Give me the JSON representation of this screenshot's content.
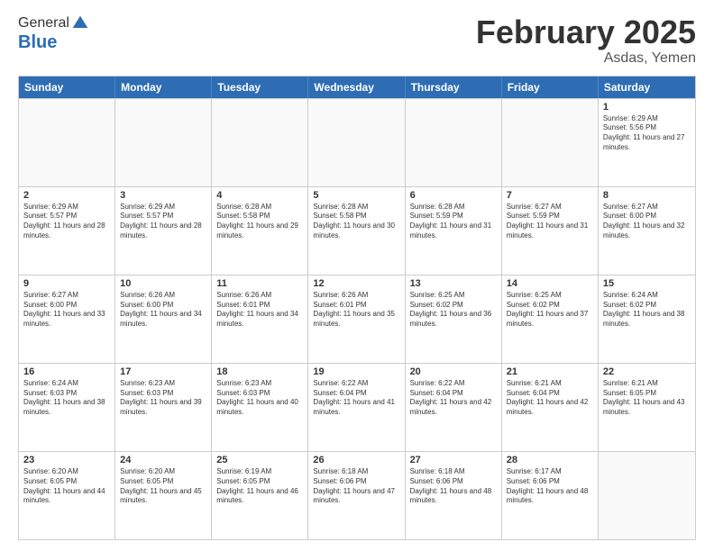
{
  "logo": {
    "general": "General",
    "blue": "Blue"
  },
  "title": "February 2025",
  "subtitle": "Asdas, Yemen",
  "headers": [
    "Sunday",
    "Monday",
    "Tuesday",
    "Wednesday",
    "Thursday",
    "Friday",
    "Saturday"
  ],
  "rows": [
    [
      {
        "day": "",
        "text": ""
      },
      {
        "day": "",
        "text": ""
      },
      {
        "day": "",
        "text": ""
      },
      {
        "day": "",
        "text": ""
      },
      {
        "day": "",
        "text": ""
      },
      {
        "day": "",
        "text": ""
      },
      {
        "day": "1",
        "text": "Sunrise: 6:29 AM\nSunset: 5:56 PM\nDaylight: 11 hours and 27 minutes."
      }
    ],
    [
      {
        "day": "2",
        "text": "Sunrise: 6:29 AM\nSunset: 5:57 PM\nDaylight: 11 hours and 28 minutes."
      },
      {
        "day": "3",
        "text": "Sunrise: 6:29 AM\nSunset: 5:57 PM\nDaylight: 11 hours and 28 minutes."
      },
      {
        "day": "4",
        "text": "Sunrise: 6:28 AM\nSunset: 5:58 PM\nDaylight: 11 hours and 29 minutes."
      },
      {
        "day": "5",
        "text": "Sunrise: 6:28 AM\nSunset: 5:58 PM\nDaylight: 11 hours and 30 minutes."
      },
      {
        "day": "6",
        "text": "Sunrise: 6:28 AM\nSunset: 5:59 PM\nDaylight: 11 hours and 31 minutes."
      },
      {
        "day": "7",
        "text": "Sunrise: 6:27 AM\nSunset: 5:59 PM\nDaylight: 11 hours and 31 minutes."
      },
      {
        "day": "8",
        "text": "Sunrise: 6:27 AM\nSunset: 6:00 PM\nDaylight: 11 hours and 32 minutes."
      }
    ],
    [
      {
        "day": "9",
        "text": "Sunrise: 6:27 AM\nSunset: 6:00 PM\nDaylight: 11 hours and 33 minutes."
      },
      {
        "day": "10",
        "text": "Sunrise: 6:26 AM\nSunset: 6:00 PM\nDaylight: 11 hours and 34 minutes."
      },
      {
        "day": "11",
        "text": "Sunrise: 6:26 AM\nSunset: 6:01 PM\nDaylight: 11 hours and 34 minutes."
      },
      {
        "day": "12",
        "text": "Sunrise: 6:26 AM\nSunset: 6:01 PM\nDaylight: 11 hours and 35 minutes."
      },
      {
        "day": "13",
        "text": "Sunrise: 6:25 AM\nSunset: 6:02 PM\nDaylight: 11 hours and 36 minutes."
      },
      {
        "day": "14",
        "text": "Sunrise: 6:25 AM\nSunset: 6:02 PM\nDaylight: 11 hours and 37 minutes."
      },
      {
        "day": "15",
        "text": "Sunrise: 6:24 AM\nSunset: 6:02 PM\nDaylight: 11 hours and 38 minutes."
      }
    ],
    [
      {
        "day": "16",
        "text": "Sunrise: 6:24 AM\nSunset: 6:03 PM\nDaylight: 11 hours and 38 minutes."
      },
      {
        "day": "17",
        "text": "Sunrise: 6:23 AM\nSunset: 6:03 PM\nDaylight: 11 hours and 39 minutes."
      },
      {
        "day": "18",
        "text": "Sunrise: 6:23 AM\nSunset: 6:03 PM\nDaylight: 11 hours and 40 minutes."
      },
      {
        "day": "19",
        "text": "Sunrise: 6:22 AM\nSunset: 6:04 PM\nDaylight: 11 hours and 41 minutes."
      },
      {
        "day": "20",
        "text": "Sunrise: 6:22 AM\nSunset: 6:04 PM\nDaylight: 11 hours and 42 minutes."
      },
      {
        "day": "21",
        "text": "Sunrise: 6:21 AM\nSunset: 6:04 PM\nDaylight: 11 hours and 42 minutes."
      },
      {
        "day": "22",
        "text": "Sunrise: 6:21 AM\nSunset: 6:05 PM\nDaylight: 11 hours and 43 minutes."
      }
    ],
    [
      {
        "day": "23",
        "text": "Sunrise: 6:20 AM\nSunset: 6:05 PM\nDaylight: 11 hours and 44 minutes."
      },
      {
        "day": "24",
        "text": "Sunrise: 6:20 AM\nSunset: 6:05 PM\nDaylight: 11 hours and 45 minutes."
      },
      {
        "day": "25",
        "text": "Sunrise: 6:19 AM\nSunset: 6:05 PM\nDaylight: 11 hours and 46 minutes."
      },
      {
        "day": "26",
        "text": "Sunrise: 6:18 AM\nSunset: 6:06 PM\nDaylight: 11 hours and 47 minutes."
      },
      {
        "day": "27",
        "text": "Sunrise: 6:18 AM\nSunset: 6:06 PM\nDaylight: 11 hours and 48 minutes."
      },
      {
        "day": "28",
        "text": "Sunrise: 6:17 AM\nSunset: 6:06 PM\nDaylight: 11 hours and 48 minutes."
      },
      {
        "day": "",
        "text": ""
      }
    ]
  ]
}
